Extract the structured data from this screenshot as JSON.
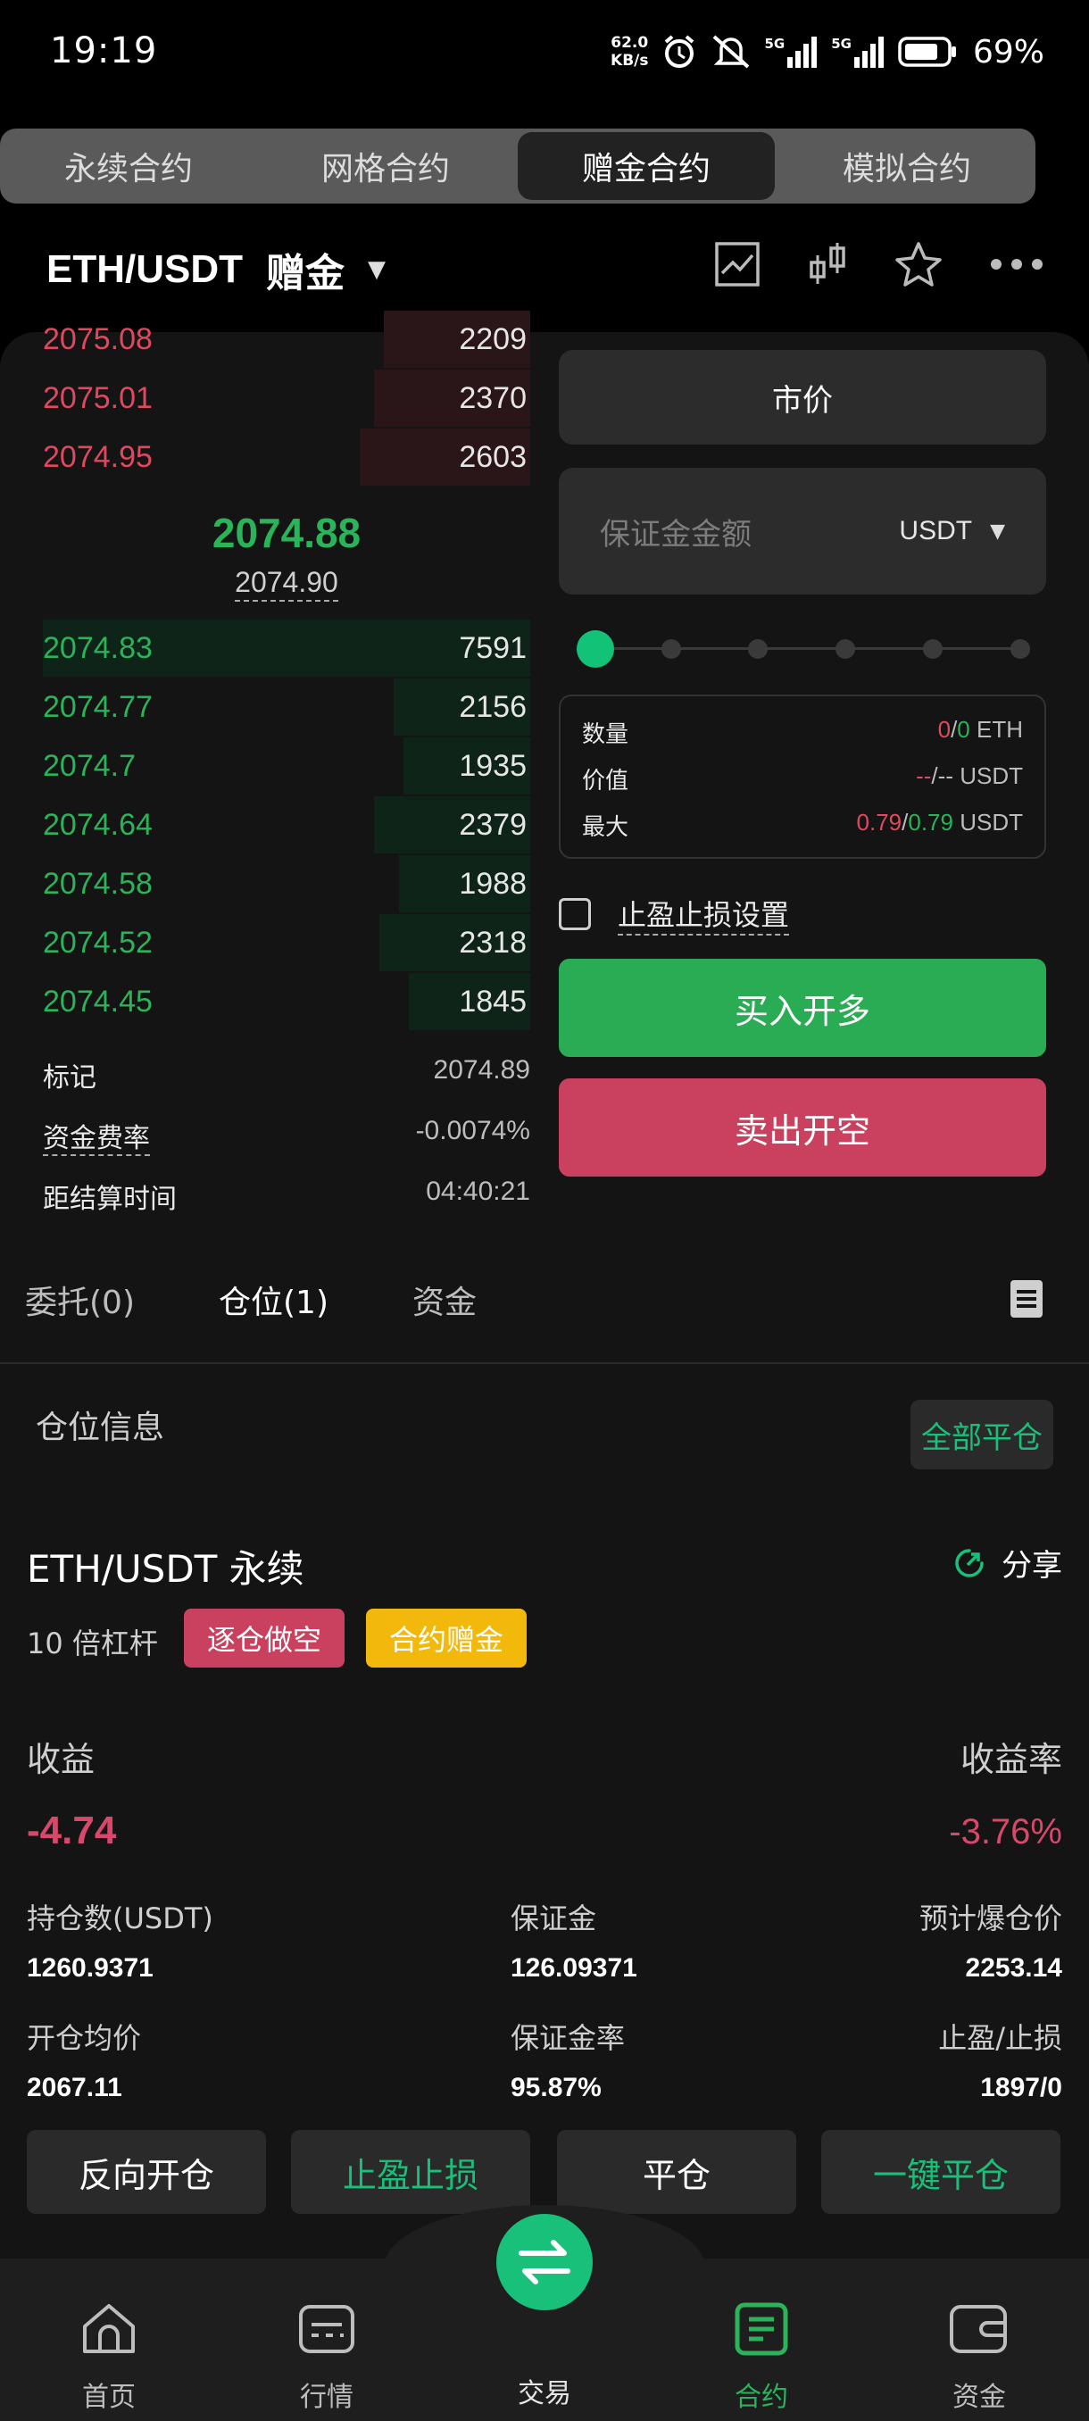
{
  "status_bar": {
    "time": "19:19",
    "net_speed_value": "62.0",
    "net_speed_unit": "KB/s",
    "signal1": "5G",
    "signal2": "5G",
    "battery": "69%"
  },
  "mode_tabs": [
    "永续合约",
    "网格合约",
    "赠金合约",
    "模拟合约"
  ],
  "header": {
    "pair": "ETH/USDT",
    "tag": "赠金"
  },
  "orderbook": {
    "asks": [
      {
        "price": "2075.08",
        "qty": "2209",
        "depth": 0.3
      },
      {
        "price": "2075.01",
        "qty": "2370",
        "depth": 0.32
      },
      {
        "price": "2074.95",
        "qty": "2603",
        "depth": 0.35
      }
    ],
    "last_price": "2074.88",
    "mark_price": "2074.90",
    "bids": [
      {
        "price": "2074.83",
        "qty": "7591",
        "depth": 1.0
      },
      {
        "price": "2074.77",
        "qty": "2156",
        "depth": 0.28
      },
      {
        "price": "2074.7",
        "qty": "1935",
        "depth": 0.26
      },
      {
        "price": "2074.64",
        "qty": "2379",
        "depth": 0.32
      },
      {
        "price": "2074.58",
        "qty": "1988",
        "depth": 0.27
      },
      {
        "price": "2074.52",
        "qty": "2318",
        "depth": 0.31
      },
      {
        "price": "2074.45",
        "qty": "1845",
        "depth": 0.25
      }
    ]
  },
  "market_info": {
    "mark_label": "标记",
    "mark_value": "2074.89",
    "funding_label": "资金费率",
    "funding_value": "-0.0074%",
    "settle_label": "距结算时间",
    "settle_value": "04:40:21"
  },
  "order_form": {
    "order_type": "市价",
    "margin_placeholder": "保证金金额",
    "currency": "USDT",
    "slider_value": 0,
    "qty_label": "数量",
    "qty_long": "0",
    "qty_short": "0",
    "qty_unit": "ETH",
    "value_label": "价值",
    "value_long": "--",
    "value_short": "--",
    "value_unit": "USDT",
    "max_label": "最大",
    "max_long": "0.79",
    "max_short": "0.79",
    "max_unit": "USDT",
    "tpsl_label": "止盈止损设置",
    "buy_label": "买入开多",
    "sell_label": "卖出开空"
  },
  "pos_tabs": {
    "orders": "委托(0)",
    "positions": "仓位(1)",
    "assets": "资金"
  },
  "position": {
    "section_label": "仓位信息",
    "close_all_label": "全部平仓",
    "title": "ETH/USDT 永续",
    "share_label": "分享",
    "leverage": "10 倍杠杆",
    "badge_mode": "逐仓做空",
    "badge_bonus": "合约赠金",
    "pnl_label": "收益",
    "pnl_value": "-4.74",
    "pnl_rate_label": "收益率",
    "pnl_rate_value": "-3.76%",
    "size_label": "持仓数(USDT)",
    "size_value": "1260.9371",
    "margin_label": "保证金",
    "margin_value": "126.09371",
    "liq_label": "预计爆仓价",
    "liq_value": "2253.14",
    "entry_label": "开仓均价",
    "entry_value": "2067.11",
    "margin_ratio_label": "保证金率",
    "margin_ratio_value": "95.87%",
    "tpsl_label": "止盈/止损",
    "tpsl_value": "1897/0",
    "actions": [
      "反向开仓",
      "止盈止损",
      "平仓",
      "一键平仓"
    ]
  },
  "bottom_nav": {
    "home": "首页",
    "market": "行情",
    "trade": "交易",
    "contract": "合约",
    "assets": "资金"
  },
  "colors": {
    "accent_green": "#19c07a",
    "buy_green": "#2aac54",
    "sell_red": "#c9415e",
    "bonus_yellow": "#f2b90c"
  }
}
